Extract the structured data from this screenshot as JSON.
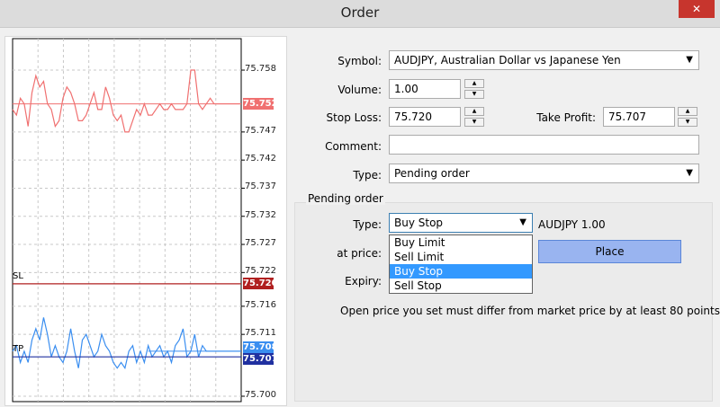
{
  "window": {
    "title": "Order",
    "close_glyph": "✕"
  },
  "chart": {
    "axis_labels": [
      "75.758",
      "75.747",
      "75.742",
      "75.737",
      "75.732",
      "75.727",
      "75.722",
      "75.716",
      "75.711",
      "75.700"
    ],
    "bid_tag": "75.752",
    "sl_tag": "75.720",
    "tp_tag": "75.707",
    "ask_tag": "75.708",
    "sl_label": "SL",
    "tp_label": "TP",
    "colors": {
      "bid": "#f07070",
      "ask": "#3a8ef0",
      "sl": "#b02020",
      "tp": "#2030a0"
    }
  },
  "chart_data": {
    "type": "line",
    "x": [
      0,
      1,
      2,
      3,
      4,
      5,
      6,
      7,
      8,
      9,
      10,
      11,
      12,
      13,
      14,
      15,
      16,
      17,
      18,
      19,
      20,
      21,
      22,
      23,
      24,
      25,
      26,
      27,
      28,
      29,
      30,
      31,
      32,
      33,
      34,
      35,
      36,
      37,
      38,
      39,
      40,
      41,
      42,
      43,
      44,
      45,
      46,
      47,
      48,
      49,
      50,
      51,
      52,
      53,
      54,
      55,
      56,
      57,
      58,
      59
    ],
    "series": [
      {
        "name": "",
        "values": [
          75.751,
          75.75,
          75.753,
          75.752,
          75.748,
          75.754,
          75.757,
          75.755,
          75.756,
          75.752,
          75.751,
          75.748,
          75.749,
          75.753,
          75.755,
          75.754,
          75.752,
          75.749,
          75.749,
          75.75,
          75.752,
          75.754,
          75.751,
          75.751,
          75.755,
          75.753,
          75.75,
          75.749,
          75.75,
          75.747,
          75.747,
          75.749,
          75.751,
          75.75,
          75.752,
          75.75,
          75.75,
          75.751,
          75.752,
          75.751,
          75.751,
          75.752,
          75.751,
          75.751,
          75.751,
          75.752,
          75.758,
          75.758,
          75.752,
          75.751,
          75.752,
          75.753,
          75.752,
          75.752,
          75.752,
          75.752,
          75.752,
          75.752,
          75.752,
          75.752
        ]
      },
      {
        "name": "",
        "values": [
          75.708,
          75.709,
          75.706,
          75.708,
          75.706,
          75.71,
          75.712,
          75.71,
          75.714,
          75.711,
          75.707,
          75.709,
          75.707,
          75.706,
          75.708,
          75.712,
          75.708,
          75.705,
          75.71,
          75.711,
          75.709,
          75.707,
          75.708,
          75.711,
          75.709,
          75.708,
          75.706,
          75.705,
          75.706,
          75.705,
          75.708,
          75.709,
          75.706,
          75.708,
          75.706,
          75.709,
          75.707,
          75.708,
          75.709,
          75.707,
          75.708,
          75.706,
          75.709,
          75.71,
          75.712,
          75.707,
          75.708,
          75.711,
          75.707,
          75.709,
          75.708,
          75.708,
          75.708,
          75.708,
          75.708,
          75.708,
          75.708,
          75.708,
          75.708,
          75.708
        ]
      }
    ],
    "levels": [
      {
        "label": "SL",
        "value": 75.72
      },
      {
        "label": "TP",
        "value": 75.707
      }
    ],
    "ylim": [
      75.7,
      75.762
    ]
  },
  "form": {
    "symbol_label": "Symbol:",
    "symbol_value": "AUDJPY, Australian Dollar vs Japanese Yen",
    "volume_label": "Volume:",
    "volume_value": "1.00",
    "sl_label": "Stop Loss:",
    "sl_value": "75.720",
    "tp_label": "Take Profit:",
    "tp_value": "75.707",
    "comment_label": "Comment:",
    "comment_value": "",
    "type_label": "Type:",
    "type_value": "Pending order"
  },
  "pending": {
    "group_title": "Pending order",
    "type_label": "Type:",
    "type_value": "Buy Stop",
    "info": "AUDJPY 1.00",
    "price_label": "at price:",
    "expiry_label": "Expiry:",
    "place_label": "Place",
    "note": "Open price you set must differ from market price by at least 80 points",
    "options": [
      "Buy Limit",
      "Sell Limit",
      "Buy Stop",
      "Sell Stop"
    ],
    "selected_index": 2
  }
}
